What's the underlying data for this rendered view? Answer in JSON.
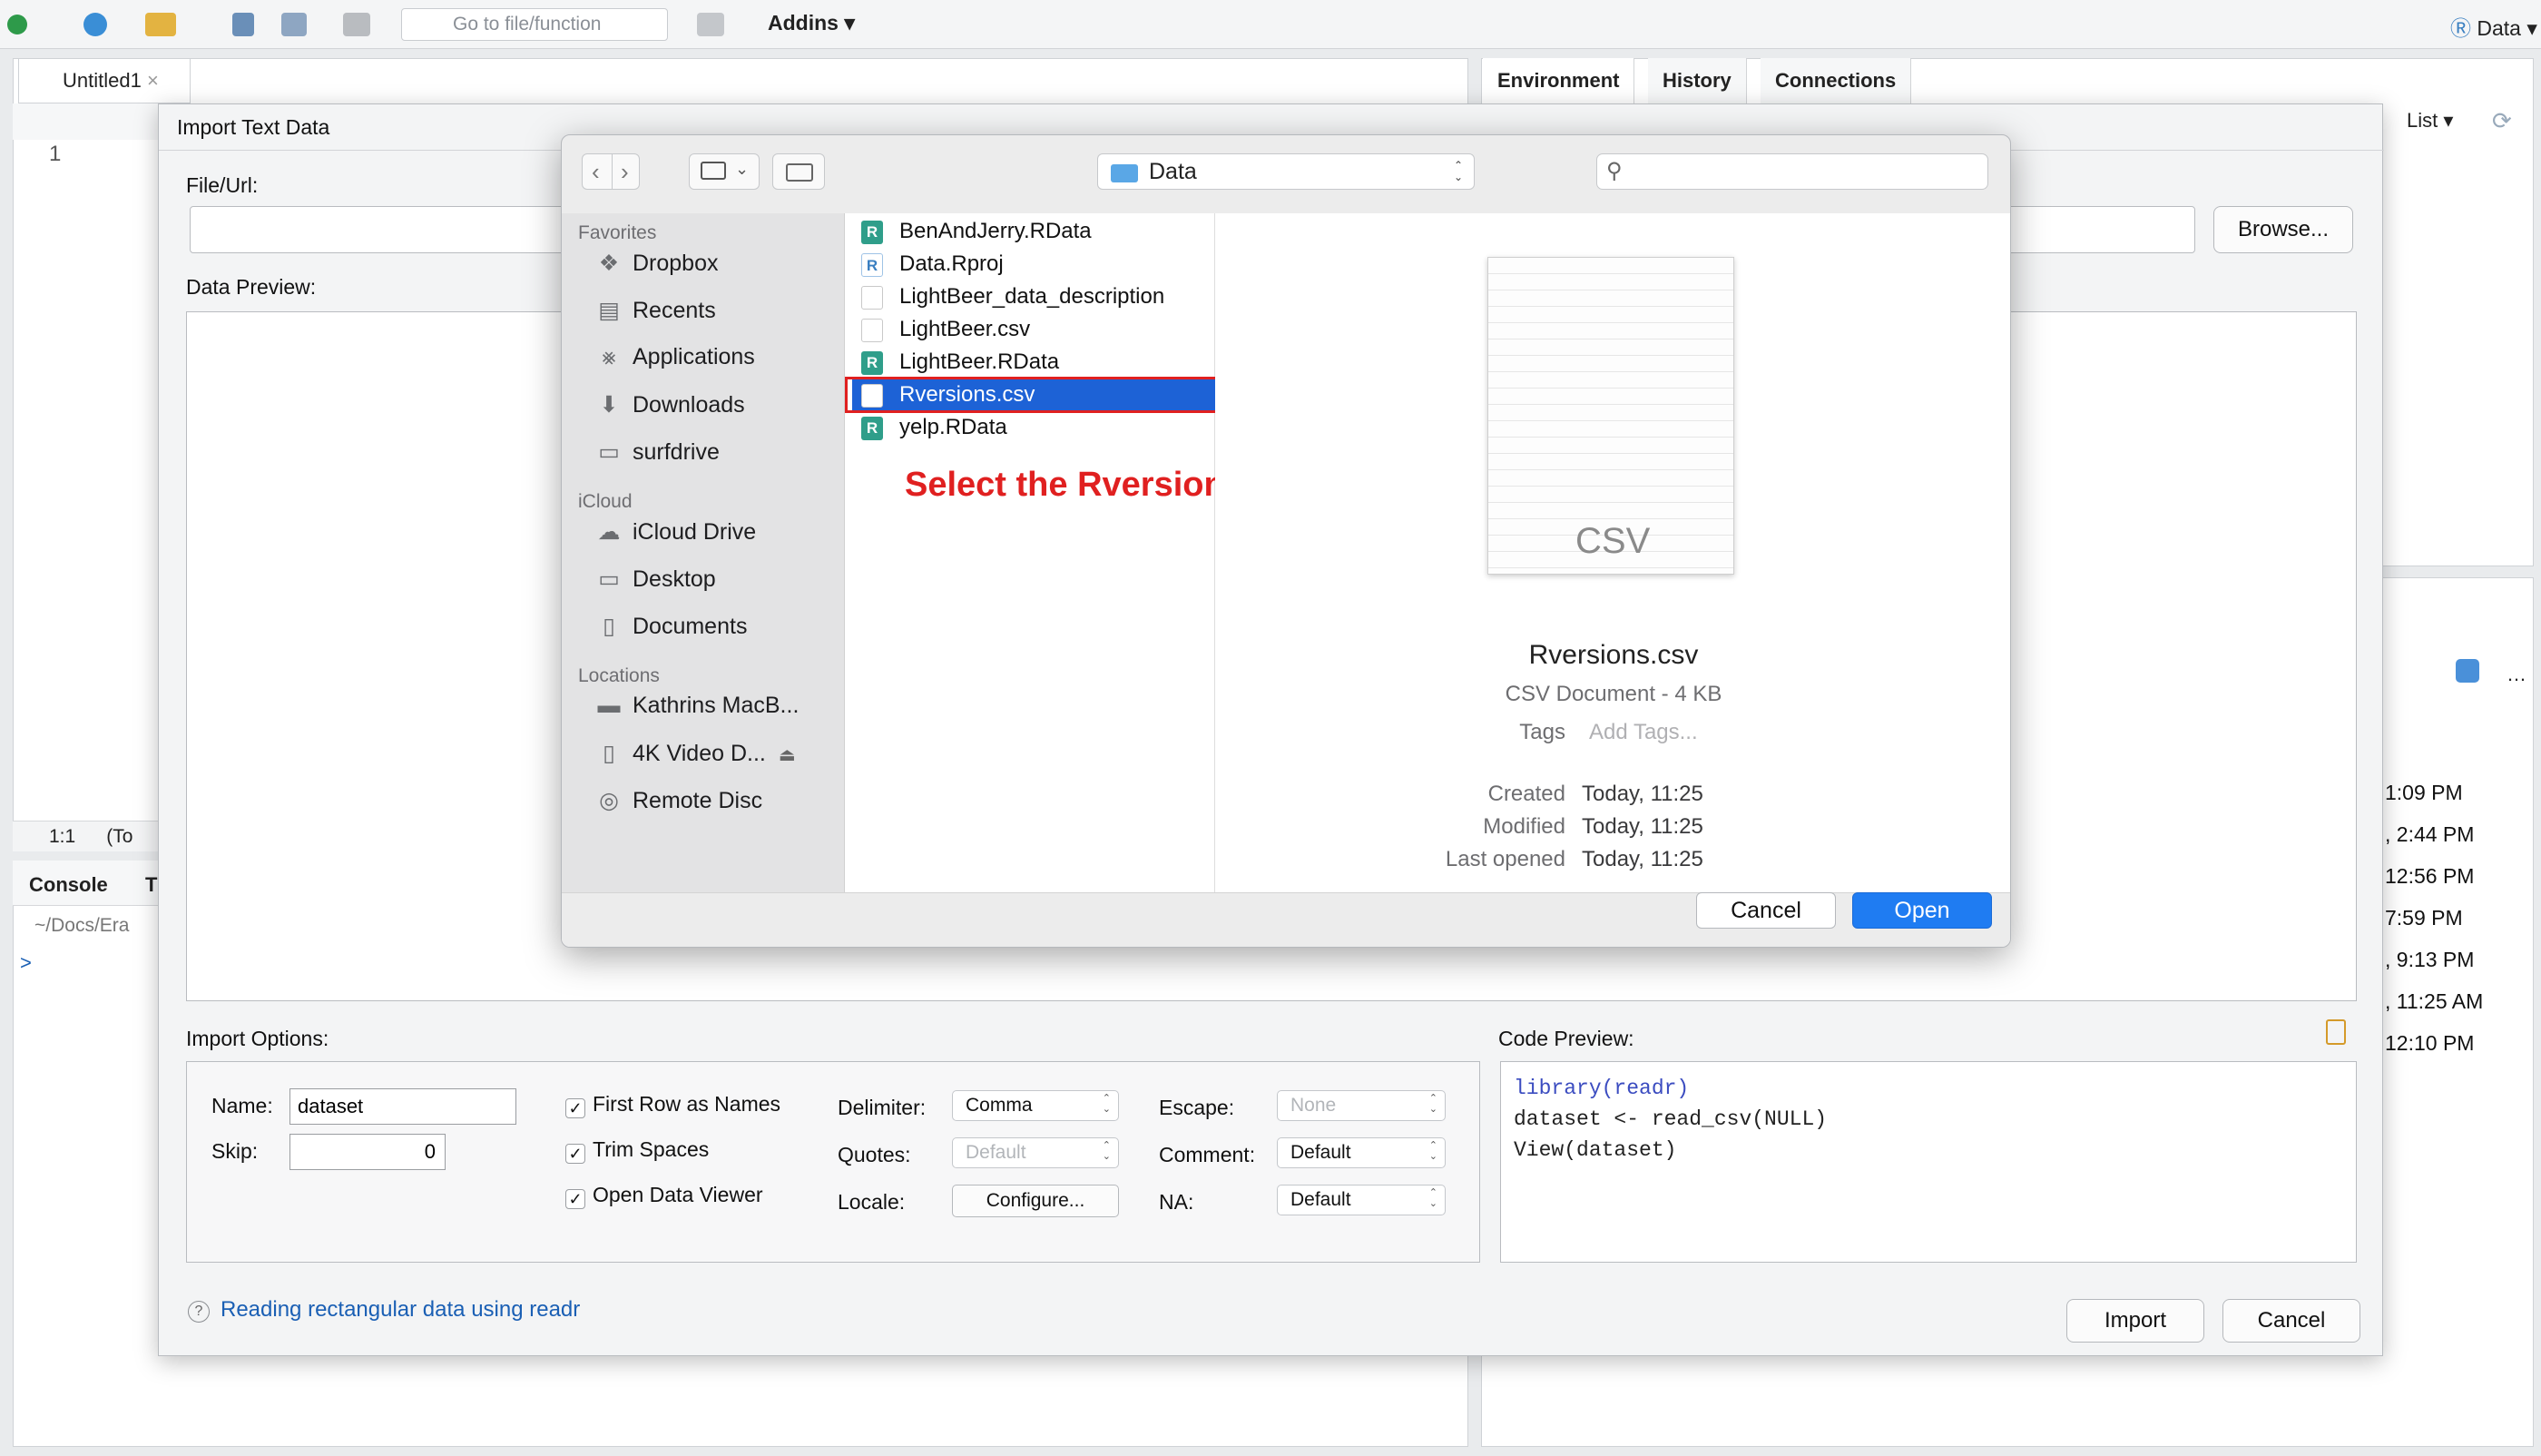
{
  "toolbar": {
    "goto_placeholder": "Go to file/function",
    "addins": "Addins",
    "project": "Data"
  },
  "source": {
    "tab": "Untitled1",
    "line_number": "1",
    "status_pos": "1:1",
    "status_scope": "(To"
  },
  "console": {
    "tab": "Console",
    "tab2": "T",
    "path": "~/Docs/Era",
    "prompt": ">"
  },
  "env": {
    "tabs": [
      "Environment",
      "History",
      "Connections"
    ],
    "list_label": "List"
  },
  "files_times": [
    "1:09 PM",
    ", 2:44 PM",
    "12:56 PM",
    "7:59 PM",
    ", 9:13 PM",
    ", 11:25 AM",
    "12:10 PM"
  ],
  "import": {
    "title": "Import Text Data",
    "file_url_label": "File/Url:",
    "browse": "Browse...",
    "data_preview_label": "Data Preview:",
    "import_options_label": "Import Options:",
    "name_label": "Name:",
    "name_value": "dataset",
    "skip_label": "Skip:",
    "skip_value": "0",
    "first_row": "First Row as Names",
    "trim": "Trim Spaces",
    "open_viewer": "Open Data Viewer",
    "check_mark": "✓",
    "delimiter_label": "Delimiter:",
    "delimiter_value": "Comma",
    "quotes_label": "Quotes:",
    "quotes_value": "Default",
    "locale_label": "Locale:",
    "locale_button": "Configure...",
    "escape_label": "Escape:",
    "escape_value": "None",
    "comment_label": "Comment:",
    "comment_value": "Default",
    "na_label": "NA:",
    "na_value": "Default",
    "code_preview_label": "Code Preview:",
    "code_lines": [
      "library(readr)",
      "dataset <- read_csv(NULL)",
      "View(dataset)"
    ],
    "help_link": "Reading rectangular data using readr",
    "import_button": "Import",
    "cancel_button": "Cancel"
  },
  "file_dialog": {
    "folder": "Data",
    "sidebar": {
      "favorites_header": "Favorites",
      "favorites": [
        "Dropbox",
        "Recents",
        "Applications",
        "Downloads",
        "surfdrive"
      ],
      "icloud_header": "iCloud",
      "icloud": [
        "iCloud Drive",
        "Desktop",
        "Documents"
      ],
      "locations_header": "Locations",
      "locations": [
        "Kathrins MacB...",
        "4K Video D...",
        "Remote Disc"
      ]
    },
    "files": [
      "BenAndJerry.RData",
      "Data.Rproj",
      "LightBeer_data_description",
      "LightBeer.csv",
      "LightBeer.RData",
      "Rversions.csv",
      "yelp.RData"
    ],
    "annotation": "Select the Rversions.csv file",
    "preview": {
      "thumb_label": "CSV",
      "name": "Rversions.csv",
      "kind": "CSV Document - 4 KB",
      "tags_label": "Tags",
      "tags_placeholder": "Add Tags...",
      "created_label": "Created",
      "created": "Today, 11:25",
      "modified_label": "Modified",
      "modified": "Today, 11:25",
      "opened_label": "Last opened",
      "opened": "Today, 11:25"
    },
    "cancel": "Cancel",
    "open": "Open"
  },
  "colors": {
    "accent": "#1d62d6",
    "annotation_red": "#e02020",
    "link": "#1a5fb4"
  }
}
